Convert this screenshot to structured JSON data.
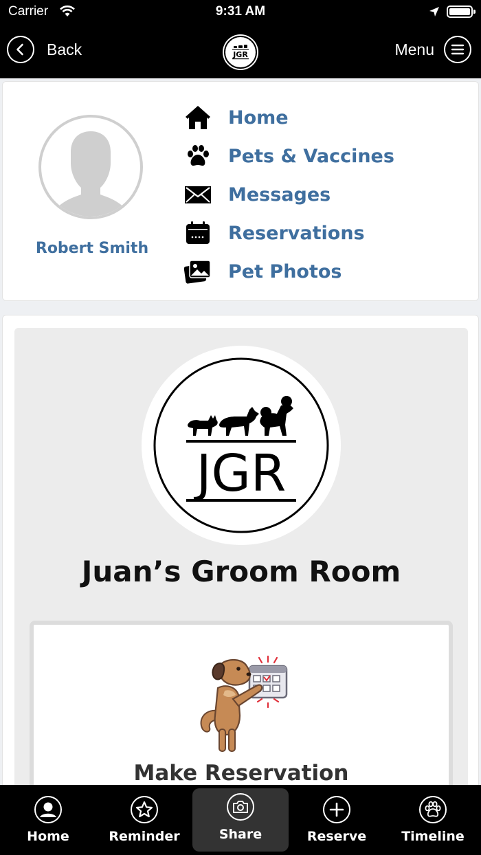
{
  "status_bar": {
    "carrier": "Carrier",
    "time": "9:31 AM"
  },
  "nav": {
    "back_label": "Back",
    "menu_label": "Menu",
    "logo_text": "JGR"
  },
  "profile": {
    "name": "Robert Smith",
    "quick_menu": [
      {
        "label": "Home",
        "icon": "home-icon"
      },
      {
        "label": "Pets & Vaccines",
        "icon": "paw-icon"
      },
      {
        "label": "Messages",
        "icon": "envelope-icon"
      },
      {
        "label": "Reservations",
        "icon": "calendar-icon"
      },
      {
        "label": "Pet Photos",
        "icon": "photos-icon"
      }
    ]
  },
  "business": {
    "logo_text": "JGR",
    "name": "Juan’s Groom Room",
    "reservation_tile_label": "Make Reservation"
  },
  "tab_bar": {
    "active": "Share",
    "tabs": [
      {
        "label": "Home",
        "icon": "user-icon"
      },
      {
        "label": "Reminder",
        "icon": "star-icon"
      },
      {
        "label": "Share",
        "icon": "camera-icon"
      },
      {
        "label": "Reserve",
        "icon": "plus-icon"
      },
      {
        "label": "Timeline",
        "icon": "paw-icon"
      }
    ]
  },
  "colors": {
    "link_blue": "#3f6f9f",
    "bar_black": "#000000",
    "active_tab_bg": "#333333"
  }
}
